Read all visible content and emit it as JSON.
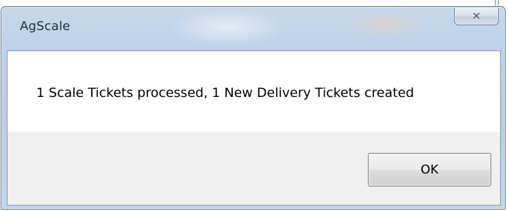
{
  "window": {
    "title": "AgScale",
    "close_glyph": "✕",
    "close_icon": "close-icon",
    "corner_fragment": "))"
  },
  "dialog": {
    "message": "1 Scale Tickets processed,  1 New Delivery Tickets created",
    "ok_label": "OK"
  },
  "colors": {
    "title_bar": "#b9cfe7",
    "button_area": "#f0f0f0",
    "message_area": "#ffffff"
  }
}
